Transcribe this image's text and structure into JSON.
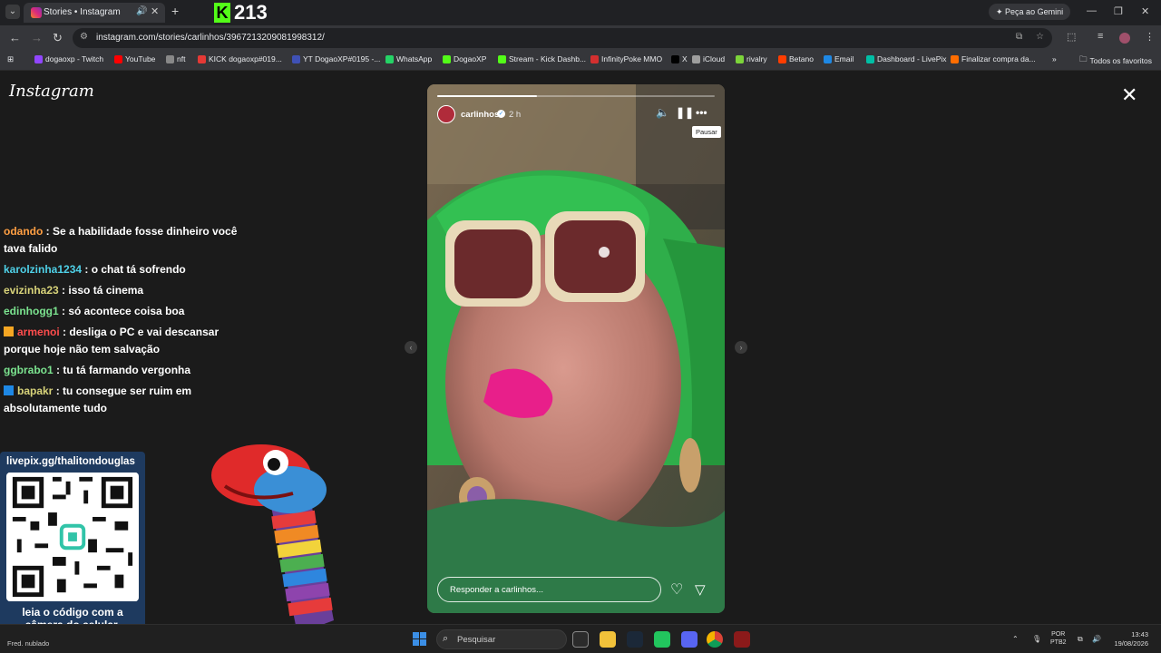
{
  "browser": {
    "tab_title": "Stories • Instagram",
    "new_tab": "+",
    "kick_count": "213",
    "gemini_label": "Peça ao Gemini",
    "url": "instagram.com/stories/carlinhos/3967213209081998312/",
    "all_bookmarks": "Todos os favoritos",
    "bookmarks": [
      {
        "label": "dogaoxp - Twitch",
        "color": "#9146ff"
      },
      {
        "label": "YouTube",
        "color": "#ff0000"
      },
      {
        "label": "nft",
        "color": "#888888"
      },
      {
        "label": "KICK dogaoxp#019...",
        "color": "#e53935"
      },
      {
        "label": "YT DogaoXP#0195 -...",
        "color": "#3f51b5"
      },
      {
        "label": "WhatsApp",
        "color": "#25d366"
      },
      {
        "label": "DogaoXP",
        "color": "#53fc18"
      },
      {
        "label": "Stream - Kick Dashb...",
        "color": "#53fc18"
      },
      {
        "label": "InfinityPoke MMO",
        "color": "#d32f2f"
      },
      {
        "label": "X",
        "color": "#000000"
      },
      {
        "label": "iCloud",
        "color": "#9e9e9e"
      },
      {
        "label": "rivalry",
        "color": "#7cd43a"
      },
      {
        "label": "Betano",
        "color": "#ff3d00"
      },
      {
        "label": "Email",
        "color": "#1e88e5"
      },
      {
        "label": "Dashboard - LivePix",
        "color": "#00bfa5"
      },
      {
        "label": "Finalizar compra da...",
        "color": "#ff6d00"
      }
    ]
  },
  "instagram": {
    "logo": "Instagram",
    "close": "✕",
    "story": {
      "username": "carlinhos",
      "time": "2 h",
      "progress": 0.36,
      "tooltip": "Pausar",
      "reply_placeholder": "Responder a carlinhos..."
    }
  },
  "chat": [
    {
      "user": "odando",
      "user_color": "#ff9f43",
      "text": ": Se a habilidade fosse dinheiro você tava falido",
      "badge": ""
    },
    {
      "user": "karolzinha1234",
      "user_color": "#4fd1e8",
      "text": ": o chat tá sofrendo",
      "badge": ""
    },
    {
      "user": "evizinha23",
      "user_color": "#d8d37a",
      "text": ": isso tá cinema",
      "badge": ""
    },
    {
      "user": "edinhogg1",
      "user_color": "#7be38f",
      "text": ": só acontece coisa boa",
      "badge": ""
    },
    {
      "user": "armenoi",
      "user_color": "#ff4d4d",
      "text": ": desliga o PC e vai descansar porque hoje não tem salvação",
      "badge": "#f5a623"
    },
    {
      "user": "ggbrabo1",
      "user_color": "#7be38f",
      "text": ": tu tá farmando vergonha",
      "badge": ""
    },
    {
      "user": "bapakr",
      "user_color": "#d8d37a",
      "text": ": tu consegue ser ruim em absolutamente tudo",
      "badge": "#1e88e5"
    }
  ],
  "livepix": {
    "title": "livepix.gg/thalitondouglas",
    "caption_line1": "leia o código com a",
    "caption_line2": "câmera do celular."
  },
  "taskbar": {
    "weather": "Fred. nublado",
    "search_placeholder": "Pesquisar",
    "lang_line1": "POR",
    "lang_line2": "PTB2",
    "time": "13:43",
    "date": "19/08/2026"
  }
}
